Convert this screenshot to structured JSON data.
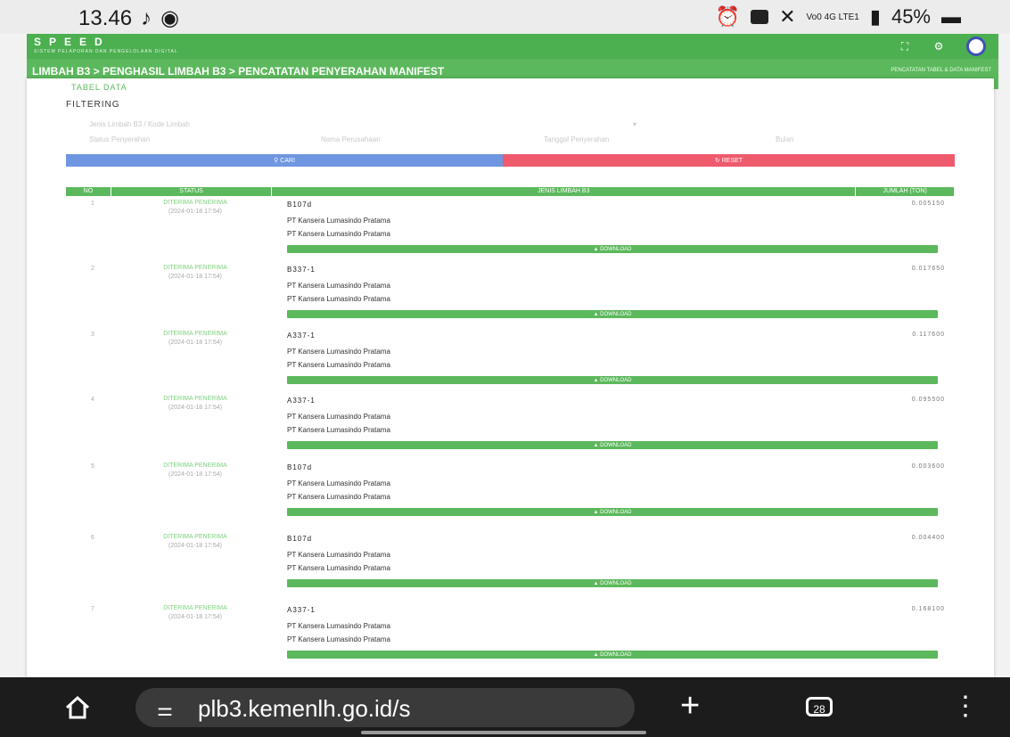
{
  "statusbar": {
    "time": "13.46",
    "left_icons": [
      "tiktok-icon",
      "cast-icon"
    ],
    "right_icons": [
      "alarm-icon",
      "message-icon",
      "mute-icon"
    ],
    "network": "Vo0 4G LTE1",
    "battery": "45%"
  },
  "app": {
    "brand": "SPEED",
    "brand_sub": "SISTEM PELAPORAN DAN PENGELOLAAN DIGITAL",
    "accent": "#4caf50"
  },
  "breadcrumb": {
    "text": "LIMBAH B3 > PENGHASIL LIMBAH B3 > PENCATATAN PENYERAHAN MANIFEST",
    "right": "PENCATATAN TABEL & DATA MANIFEST"
  },
  "main": {
    "tab_label": "TABEL DATA",
    "filtering_title": "FILTERING",
    "filter_placeholder": "Jenis Limbah B3 / Kode Limbah",
    "selects": [
      "Status Penyerahan",
      "Nama Perusahaan",
      "Tanggal Penyerahan",
      "Bulan"
    ],
    "search_label": "CARI",
    "reset_label": "RESET",
    "columns": [
      "NO",
      "STATUS",
      "JENIS LIMBAH B3",
      "JUMLAH (TON)"
    ],
    "download_label": "DOWNLOAD",
    "rows": [
      {
        "no": "1",
        "status": "DITERIMA PENERIMA",
        "date": "(2024-01-18 17:54)",
        "code": "B107d",
        "qty": "0.005150",
        "company1": "PT Kansera Lumasindo Pratama",
        "company2": "PT Kansera Lumasindo Pratama"
      },
      {
        "no": "2",
        "status": "DITERIMA PENERIMA",
        "date": "(2024-01-18 17:54)",
        "code": "B337-1",
        "qty": "0.017650",
        "company1": "PT Kansera Lumasindo Pratama",
        "company2": "PT Kansera Lumasindo Pratama"
      },
      {
        "no": "3",
        "status": "DITERIMA PENERIMA",
        "date": "(2024-01-18 17:54)",
        "code": "A337-1",
        "qty": "0.117600",
        "company1": "PT Kansera Lumasindo Pratama",
        "company2": "PT Kansera Lumasindo Pratama"
      },
      {
        "no": "4",
        "status": "DITERIMA PENERIMA",
        "date": "(2024-01-18 17:54)",
        "code": "A337-1",
        "qty": "0.095500",
        "company1": "PT Kansera Lumasindo Pratama",
        "company2": "PT Kansera Lumasindo Pratama"
      },
      {
        "no": "5",
        "status": "DITERIMA PENERIMA",
        "date": "(2024-01-18 17:54)",
        "code": "B107d",
        "qty": "0.003600",
        "company1": "PT Kansera Lumasindo Pratama",
        "company2": "PT Kansera Lumasindo Pratama"
      },
      {
        "no": "6",
        "status": "DITERIMA PENERIMA",
        "date": "(2024-01-18 17:54)",
        "code": "B107d",
        "qty": "0.004400",
        "company1": "PT Kansera Lumasindo Pratama",
        "company2": "PT Kansera Lumasindo Pratama"
      },
      {
        "no": "7",
        "status": "DITERIMA PENERIMA",
        "date": "(2024-01-18 17:54)",
        "code": "A337-1",
        "qty": "0.168100",
        "company1": "PT Kansera Lumasindo Pratama",
        "company2": "PT Kansera Lumasindo Pratama"
      }
    ]
  },
  "browser": {
    "url": "plb3.kemenlh.go.id/s",
    "tab_count": "28"
  }
}
